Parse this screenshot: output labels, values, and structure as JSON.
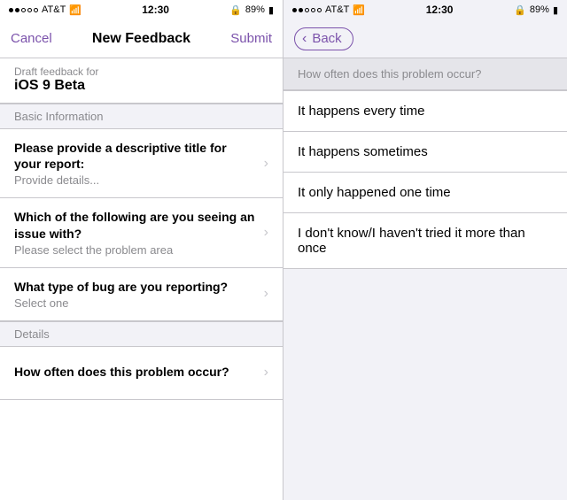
{
  "left": {
    "status_bar": {
      "carrier": "AT&T",
      "wifi": "wifi",
      "time": "12:30",
      "lock": "🔒",
      "battery": "89%"
    },
    "nav": {
      "cancel_label": "Cancel",
      "title": "New Feedback",
      "submit_label": "Submit"
    },
    "draft_info": {
      "sub_label": "Draft feedback for",
      "title": "iOS 9 Beta"
    },
    "section_basic": "Basic Information",
    "form_rows": [
      {
        "label": "Please provide a descriptive title for your report:",
        "placeholder": "Provide details..."
      },
      {
        "label": "Which of the following are you seeing an issue with?",
        "placeholder": "Please select the problem area"
      },
      {
        "label": "What type of bug are you reporting?",
        "placeholder": "Select one"
      }
    ],
    "section_details": "Details",
    "details_question": {
      "label": "How often does this problem occur?",
      "placeholder": ""
    }
  },
  "right": {
    "status_bar": {
      "carrier": "AT&T",
      "wifi": "wifi",
      "time": "12:30",
      "lock": "🔒",
      "battery": "89%"
    },
    "nav": {
      "back_label": "Back"
    },
    "question": "How often does this problem occur?",
    "options": [
      "It happens every time",
      "It happens sometimes",
      "It only happened one time",
      "I don't know/I haven't tried it more than once"
    ]
  }
}
